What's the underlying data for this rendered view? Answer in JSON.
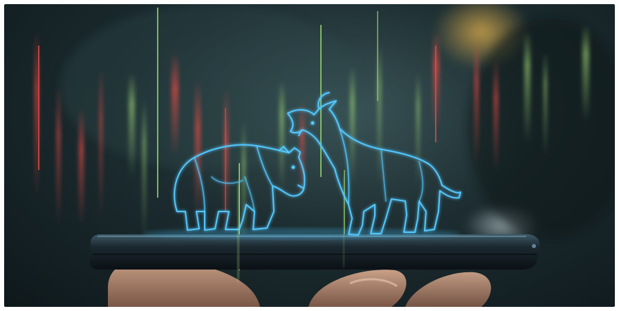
{
  "scene": {
    "subject": "bull-and-bear-hologram-on-smartphone",
    "colors": {
      "background_dark": "#0e181b",
      "background_mid": "#2a4145",
      "hologram": "#48c8ff",
      "hologram_glow": "#9be6ff",
      "candle_green": "#8fd66a",
      "candle_red": "#e0413c",
      "phone_body": "#121a1f",
      "skin": "#c79a80",
      "warm_light": "#d6a64a"
    },
    "icons": {
      "bear": "bear-hologram-icon",
      "bull": "bull-hologram-icon"
    }
  }
}
